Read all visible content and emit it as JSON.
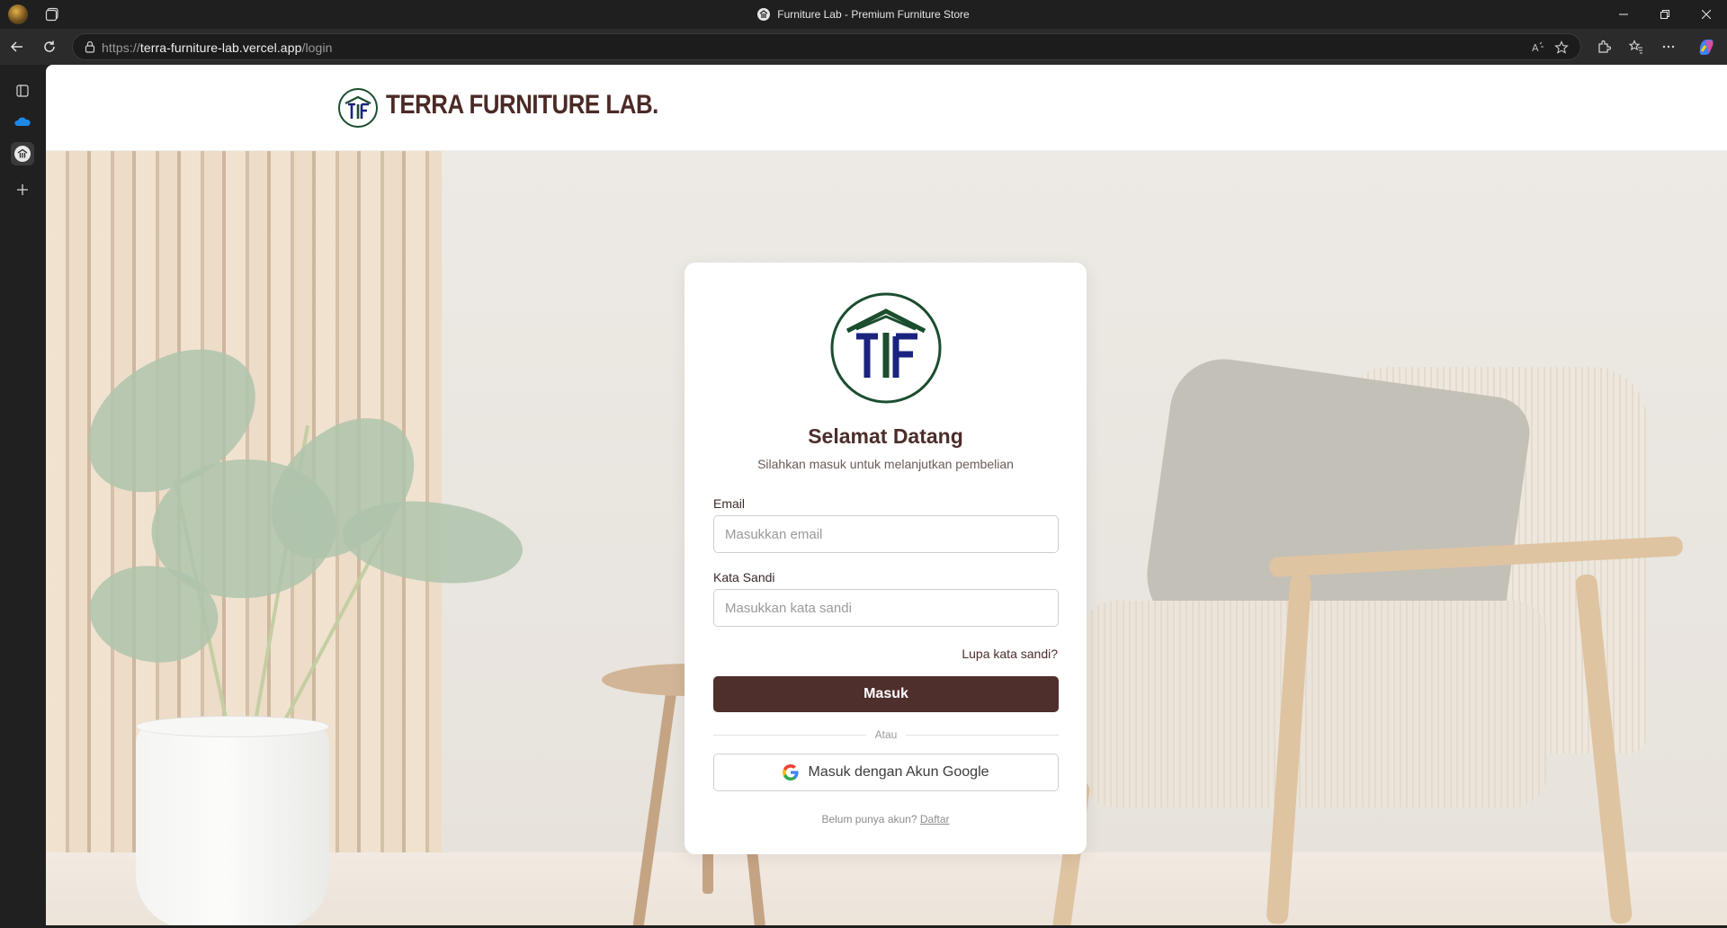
{
  "browser": {
    "tab_title": "Furniture Lab - Premium Furniture Store",
    "url_scheme": "https://",
    "url_host": "terra-furniture-lab.vercel.app",
    "url_path": "/login"
  },
  "header": {
    "brand_name": "TERRA FURNITURE LAB.",
    "brand_colors": {
      "primary": "#4b2a25",
      "logo_blue": "#1a237e",
      "logo_green": "#1b4d2e"
    }
  },
  "login": {
    "title": "Selamat Datang",
    "subtitle": "Silahkan masuk untuk melanjutkan pembelian",
    "email_label": "Email",
    "email_placeholder": "Masukkan email",
    "email_value": "",
    "password_label": "Kata Sandi",
    "password_placeholder": "Masukkan kata sandi",
    "password_value": "",
    "forgot_label": "Lupa kata sandi?",
    "submit_label": "Masuk",
    "divider_label": "Atau",
    "google_label": "Masuk dengan Akun Google",
    "signup_prompt": "Belum punya akun?",
    "signup_link": "Daftar",
    "button_color": "#4f2f2c"
  },
  "icons": [
    "app-profile-icon",
    "tab-actions-icon",
    "back-icon",
    "refresh-icon",
    "lock-icon",
    "read-aloud-icon",
    "favorite-star-icon",
    "extensions-icon",
    "favorites-icon",
    "more-icon",
    "copilot-icon",
    "google-icon"
  ]
}
